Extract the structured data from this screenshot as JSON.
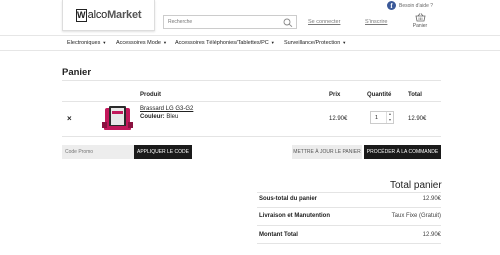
{
  "top": {
    "help_text": "Besoin d'aide ?"
  },
  "logo": {
    "letter": "W",
    "alco": "alco",
    "market": "Market"
  },
  "header": {
    "search_placeholder": "Recherche",
    "login": "Se connecter",
    "register": "S'inscrire",
    "basket": "Panier"
  },
  "nav": [
    {
      "label": "Electroniques"
    },
    {
      "label": "Accessoires Mode"
    },
    {
      "label": "Accessoires Téléphonies/Tablettes/PC"
    },
    {
      "label": "Surveillance/Protection"
    }
  ],
  "page_title": "Panier",
  "cart": {
    "headers": {
      "product": "Produit",
      "price": "Prix",
      "quantity": "Quantité",
      "total": "Total"
    },
    "items": [
      {
        "remove": "×",
        "name": "Brassard LG G3-G2",
        "color_label": "Couleur:",
        "color_value": "Bleu",
        "price": "12.90€",
        "qty": "1",
        "total": "12.90€"
      }
    ]
  },
  "coupon": {
    "placeholder": "Code Promo",
    "apply": "Appliquer le code"
  },
  "actions": {
    "update": "Mettre à jour le panier",
    "checkout": "Procéder à la commande"
  },
  "totals": {
    "title": "Total panier",
    "rows": [
      {
        "label": "Sous-total du panier",
        "value": "12.90€"
      },
      {
        "label": "Livraison et Manutention",
        "value": "Taux Fixe (Gratuit)"
      },
      {
        "label": "Montant Total",
        "value": "12.90€"
      }
    ]
  },
  "colors": {
    "brand_dark": "#1a1a1a",
    "facebook": "#3b5998",
    "product_accent": "#c2185b"
  }
}
